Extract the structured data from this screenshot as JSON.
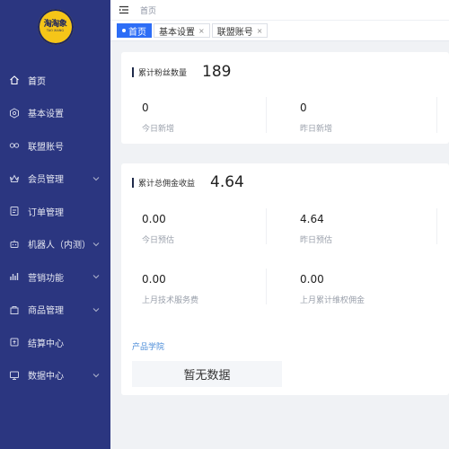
{
  "brand": {
    "logo_text": "淘淘象",
    "logo_sub": "TAO XIANG",
    "accent": "#2d6df6",
    "sidebar_bg": "#2b3680"
  },
  "sidebar": {
    "items": [
      {
        "label": "首页",
        "icon": "home-icon",
        "active": true,
        "has_caret": false
      },
      {
        "label": "基本设置",
        "icon": "settings-icon",
        "has_caret": false
      },
      {
        "label": "联盟账号",
        "icon": "link-icon",
        "has_caret": false
      },
      {
        "label": "会员管理",
        "icon": "crown-icon",
        "has_caret": true
      },
      {
        "label": "订单管理",
        "icon": "order-icon",
        "has_caret": false
      },
      {
        "label": "机器人（内测）",
        "icon": "robot-icon",
        "has_caret": true
      },
      {
        "label": "营销功能",
        "icon": "chart-icon",
        "has_caret": true
      },
      {
        "label": "商品管理",
        "icon": "goods-icon",
        "has_caret": true
      },
      {
        "label": "结算中心",
        "icon": "settle-icon",
        "has_caret": false
      },
      {
        "label": "数据中心",
        "icon": "monitor-icon",
        "has_caret": true
      }
    ]
  },
  "topbar": {
    "breadcrumb": "首页",
    "menu_icon": "hamburger-icon"
  },
  "tabs": [
    {
      "label": "首页",
      "active": true
    },
    {
      "label": "基本设置",
      "active": false,
      "close": "×"
    },
    {
      "label": "联盟账号",
      "active": false,
      "close": "×"
    }
  ],
  "fans": {
    "title": "累计粉丝数量",
    "total": "189",
    "stats": [
      {
        "value": "0",
        "label": "今日新增"
      },
      {
        "value": "0",
        "label": "昨日新增"
      }
    ]
  },
  "commission": {
    "title": "累计总佣金收益",
    "total": "4.64",
    "stats": [
      {
        "value": "0.00",
        "label": "今日预估"
      },
      {
        "value": "4.64",
        "label": "昨日预估"
      },
      {
        "value": "0.00",
        "label": "上月技术服务费"
      },
      {
        "value": "0.00",
        "label": "上月累计维权佣金"
      }
    ]
  },
  "academy": {
    "title": "产品学院",
    "empty_text": "暂无数据"
  }
}
